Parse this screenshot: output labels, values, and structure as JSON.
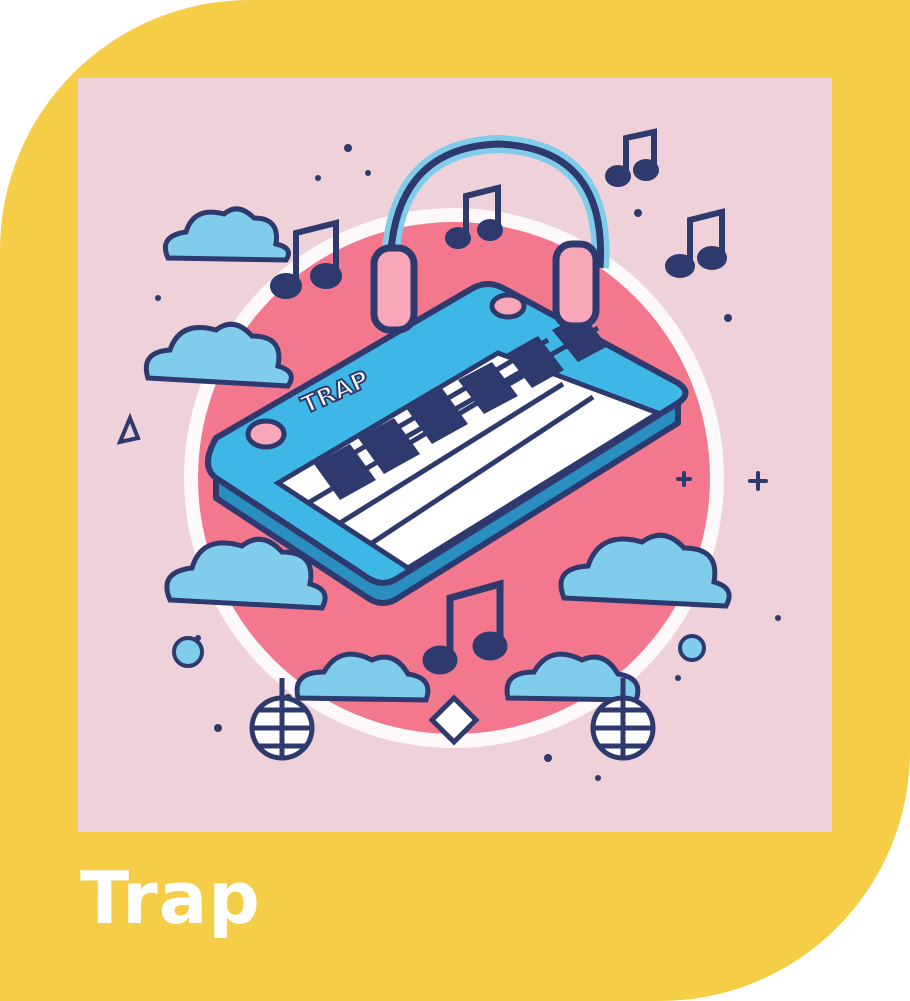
{
  "card": {
    "title": "Trap",
    "artwork_text": "TRAP",
    "background_color": "#F6CD47",
    "art_background_color": "#EED1D9"
  },
  "icons": [
    "headphones-icon",
    "piano-keyboard-icon",
    "music-note-icon",
    "cloud-icon",
    "disco-ball-icon",
    "sparkle-icon"
  ]
}
